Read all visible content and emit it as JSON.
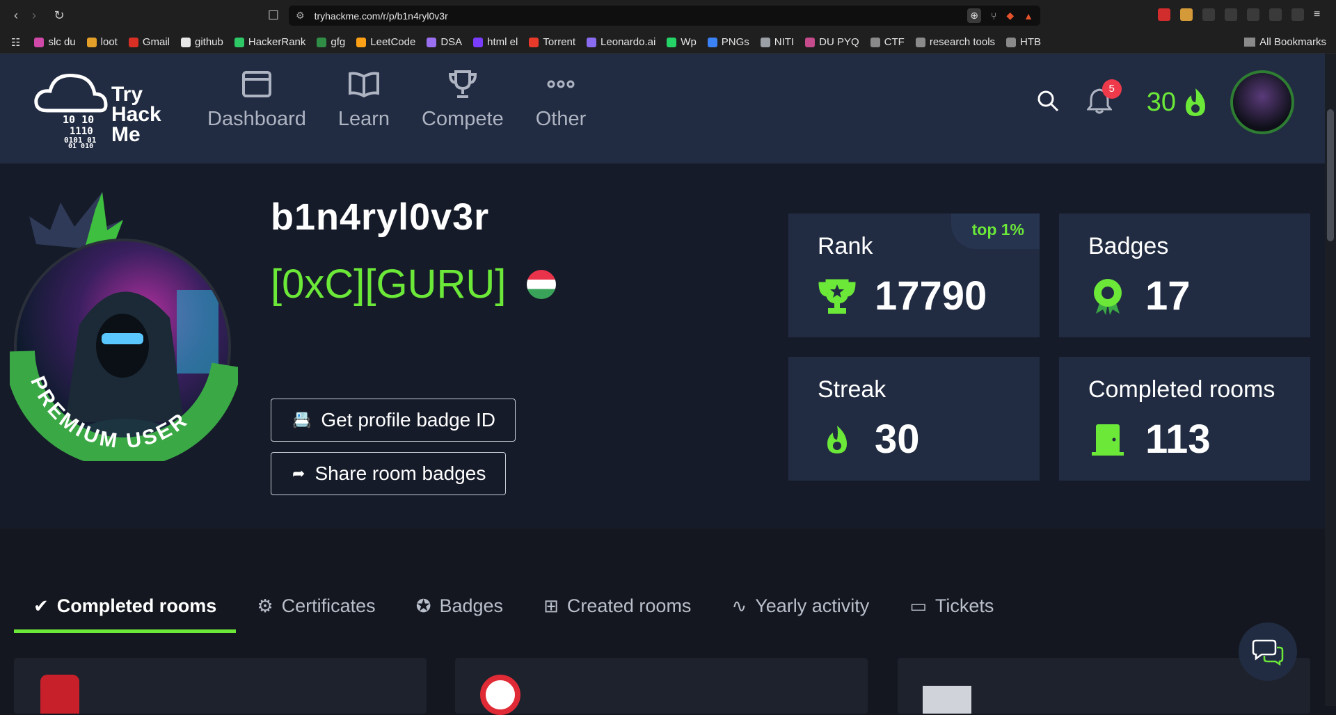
{
  "browser": {
    "url": "tryhackme.com/r/p/b1n4ryl0v3r",
    "bookmarks": [
      {
        "label": "slc du",
        "color": "#d048a8"
      },
      {
        "label": "loot",
        "color": "#e5a02a"
      },
      {
        "label": "Gmail",
        "color": "#d93025"
      },
      {
        "label": "github",
        "color": "#e6e6e6"
      },
      {
        "label": "HackerRank",
        "color": "#2ec866"
      },
      {
        "label": "gfg",
        "color": "#2f8d46"
      },
      {
        "label": "LeetCode",
        "color": "#ffa116"
      },
      {
        "label": "DSA",
        "color": "#9a6ff0"
      },
      {
        "label": "html el",
        "color": "#7a3cff"
      },
      {
        "label": "Torrent",
        "color": "#e83a2a"
      },
      {
        "label": "Leonardo.ai",
        "color": "#8a6cf0"
      },
      {
        "label": "Wp",
        "color": "#25d366"
      },
      {
        "label": "PNGs",
        "color": "#3b82f6"
      },
      {
        "label": "NITI",
        "color": "#9aa0a6"
      },
      {
        "label": "DU PYQ",
        "color": "#c54b8c"
      },
      {
        "label": "CTF",
        "color": "#8a8a8a"
      },
      {
        "label": "research tools",
        "color": "#8a8a8a"
      },
      {
        "label": "HTB",
        "color": "#8a8a8a"
      }
    ],
    "all_bookmarks": "All Bookmarks"
  },
  "header": {
    "logo_lines": [
      "Try",
      "Hack",
      "Me"
    ],
    "nav": [
      "Dashboard",
      "Learn",
      "Compete",
      "Other"
    ],
    "notification_count": "5",
    "streak": "30"
  },
  "profile": {
    "username": "b1n4ryl0v3r",
    "rank_title": "[0xC][GURU]",
    "premium_label": "PREMIUM USER",
    "btn_badge_id": "Get profile badge ID",
    "btn_share": "Share room badges"
  },
  "stats": {
    "rank_label": "Rank",
    "rank_value": "17790",
    "rank_badge": "top 1%",
    "badges_label": "Badges",
    "badges_value": "17",
    "streak_label": "Streak",
    "streak_value": "30",
    "rooms_label": "Completed rooms",
    "rooms_value": "113"
  },
  "tabs": [
    "Completed rooms",
    "Certificates",
    "Badges",
    "Created rooms",
    "Yearly activity",
    "Tickets"
  ],
  "colors": {
    "accent": "#6be838",
    "header_bg": "#212c42",
    "page_bg": "#161b29"
  }
}
